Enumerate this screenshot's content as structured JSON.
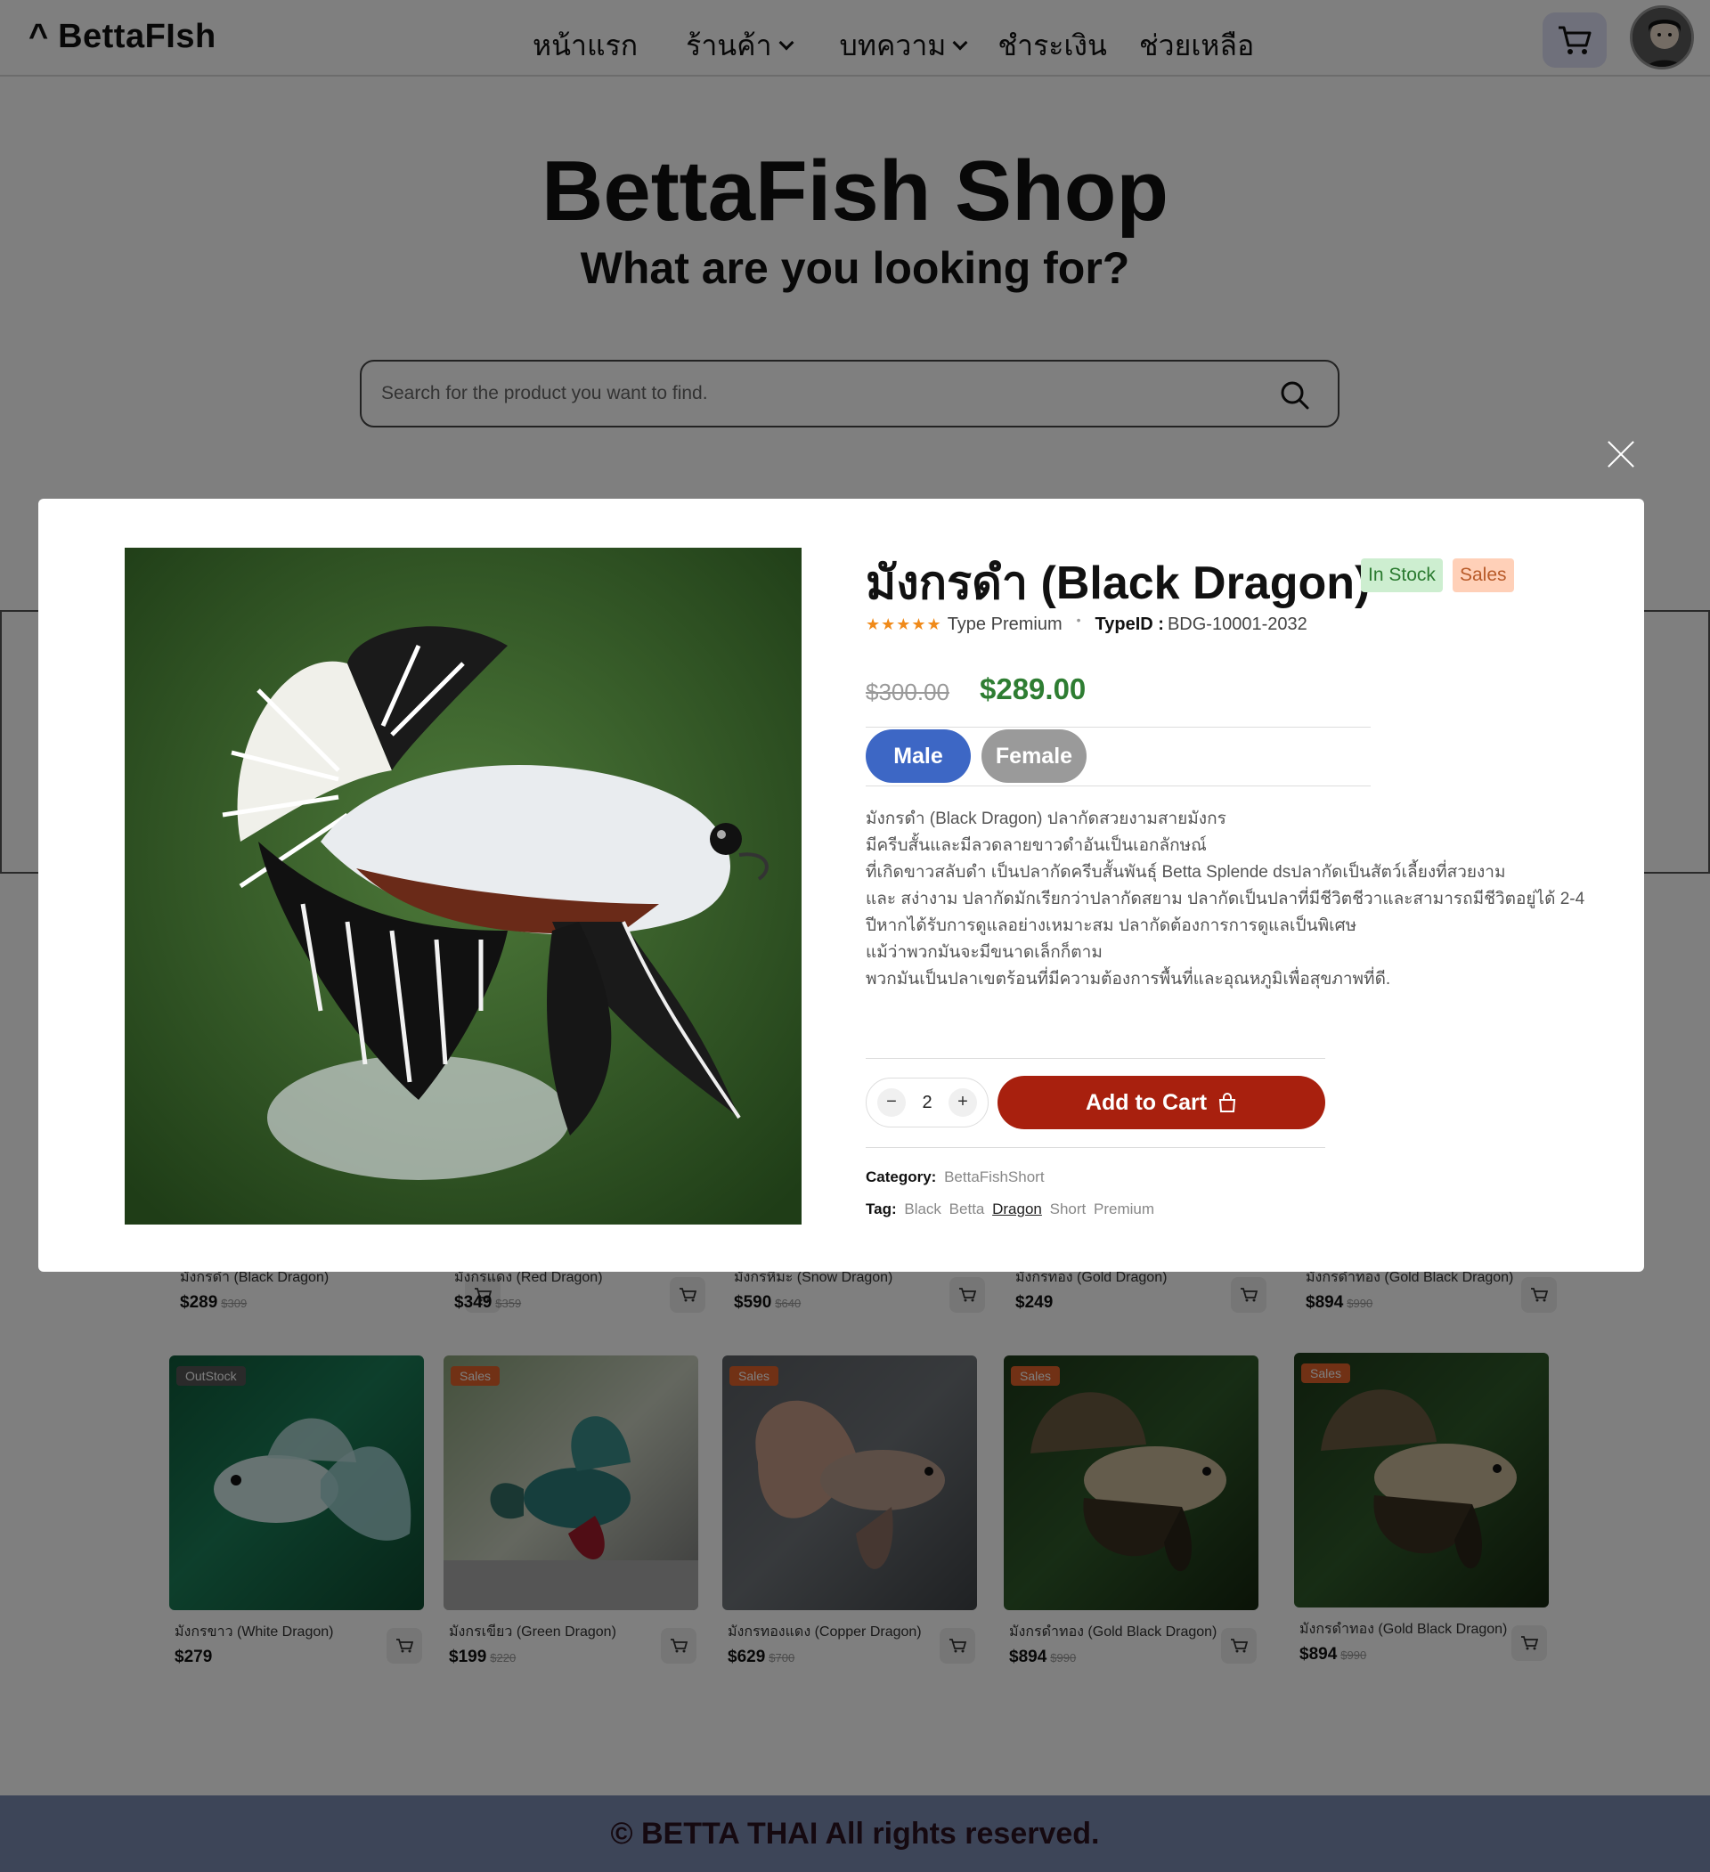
{
  "nav": {
    "logo": "BettaFIsh",
    "menu": [
      "หน้าแรก",
      "ร้านค้า",
      "บทความ",
      "ชำระเงิน",
      "ช่วยเหลือ"
    ]
  },
  "hero": {
    "title": "BettaFish Shop",
    "subtitle": "What are you looking for?"
  },
  "search": {
    "placeholder": "Search for the product you want to find."
  },
  "grid": {
    "row1": [
      {
        "name": "มังกรดำ (Black Dragon)",
        "price": "$289",
        "old": "$309"
      },
      {
        "name": "มังกรแดง (Red Dragon)",
        "price": "$349",
        "old": "$359"
      },
      {
        "name": "มังกรหิมะ (Snow Dragon)",
        "price": "$590",
        "old": "$640"
      },
      {
        "name": "มังกรทอง (Gold Dragon)",
        "price": "$249",
        "old": ""
      },
      {
        "name": "มังกรดำทอง (Gold Black Dragon)",
        "price": "$894",
        "old": "$990"
      }
    ],
    "row2": [
      {
        "badge": "OutStock",
        "name": "มังกรขาว (White Dragon)",
        "price": "$279",
        "old": ""
      },
      {
        "badge": "Sales",
        "name": "มังกรเขียว (Green Dragon)",
        "price": "$199",
        "old": "$220"
      },
      {
        "badge": "Sales",
        "name": "มังกรทองแดง (Copper Dragon)",
        "price": "$629",
        "old": "$700"
      },
      {
        "badge": "Sales",
        "name": "มังกรดำทอง (Gold Black Dragon)",
        "price": "$894",
        "old": "$990"
      },
      {
        "badge": "Sales",
        "name": "มังกรดำทอง (Gold Black Dragon)",
        "price": "$894",
        "old": "$990"
      }
    ]
  },
  "footer": {
    "text": "© BETTA THAI All rights reserved."
  },
  "modal": {
    "title": "มังกรดำ (Black Dragon)",
    "stock_badge": "In Stock",
    "sales_badge": "Sales",
    "rating": 5,
    "stars": "★★★★★",
    "type_text": "Type Premium",
    "typeid_label": "TypeID :",
    "typeid_value": "BDG-10001-2032",
    "old_price": "$300.00",
    "price": "$289.00",
    "gender": [
      "Male",
      "Female"
    ],
    "description": [
      "มังกรดำ (Black Dragon) ปลากัดสวยงามสายมังกร",
      "มีครีบสั้นและมีลวดลายขาวดำอันเป็นเอกลักษณ์",
      "ที่เกิดขาวสลับดำ เป็นปลากัดครีบสั้นพันธุ์ Betta Splende dsปลากัดเป็นสัตว์เลี้ยงที่สวยงาม",
      "และ สง่างาม ปลากัดมักเรียกว่าปลากัดสยาม ปลากัดเป็นปลาที่มีชีวิตชีวาและสามารถมีชีวิตอยู่ได้ 2-4",
      "ปีหากได้รับการดูแลอย่างเหมาะสม ปลากัดต้องการการดูแลเป็นพิเศษ",
      "แม้ว่าพวกมันจะมีขนาดเล็กก็ตาม",
      "พวกมันเป็นปลาเขตร้อนที่มีความต้องการพื้นที่และอุณหภูมิเพื่อสุขภาพที่ดี."
    ],
    "qty_minus": "−",
    "qty_value": "2",
    "qty_plus": "+",
    "add_to_cart": "Add to Cart",
    "category_label": "Category:",
    "category_value": "BettaFishShort",
    "tag_label": "Tag:",
    "tags": [
      "Black",
      "Betta",
      "Dragon",
      "Short",
      "Premium"
    ]
  },
  "colors": {
    "accent_blue": "#3d67c5",
    "add_to_cart": "#a8200e",
    "price_green": "#2e7d32",
    "footer_bg": "#7b8bb0"
  }
}
